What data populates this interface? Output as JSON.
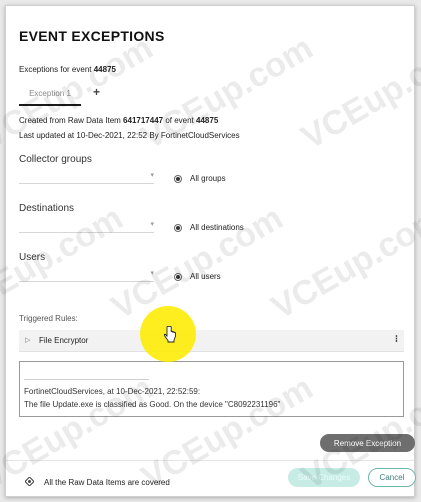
{
  "dialog": {
    "title": "EVENT EXCEPTIONS",
    "exceptions_prefix": "Exceptions for event ",
    "event_id": "44875"
  },
  "tabs": {
    "active_label": "Exception 1",
    "add_label": "+"
  },
  "meta": {
    "created_prefix": "Created from Raw Data Item ",
    "raw_item_id": "641717447",
    "created_mid": " of event ",
    "event_id": "44875",
    "updated": "Last updated at 10-Dec-2021, 22:52 By FortinetCloudServices"
  },
  "collector_groups": {
    "label": "Collector groups",
    "radio_label": "All groups"
  },
  "destinations": {
    "label": "Destinations",
    "radio_label": "All destinations"
  },
  "users": {
    "label": "Users",
    "radio_label": "All users"
  },
  "triggered_rules": {
    "label": "Triggered Rules:",
    "rule_name": "File Encryptor",
    "menu_glyph": "⁝"
  },
  "comment": {
    "line1": "FortinetCloudServices, at 10-Dec-2021, 22:52:59:",
    "line2": "The file Update.exe is classified as Good. On the device \"C8092231196\""
  },
  "buttons": {
    "remove": "Remove Exception",
    "save": "Save Changes",
    "cancel": "Cancel"
  },
  "footer": {
    "coverage_text": "All the Raw Data Items are covered"
  },
  "watermark": {
    "text": "VCEup.com"
  },
  "colors": {
    "accent": "#6fb6ad",
    "highlight": "#ffec00"
  }
}
